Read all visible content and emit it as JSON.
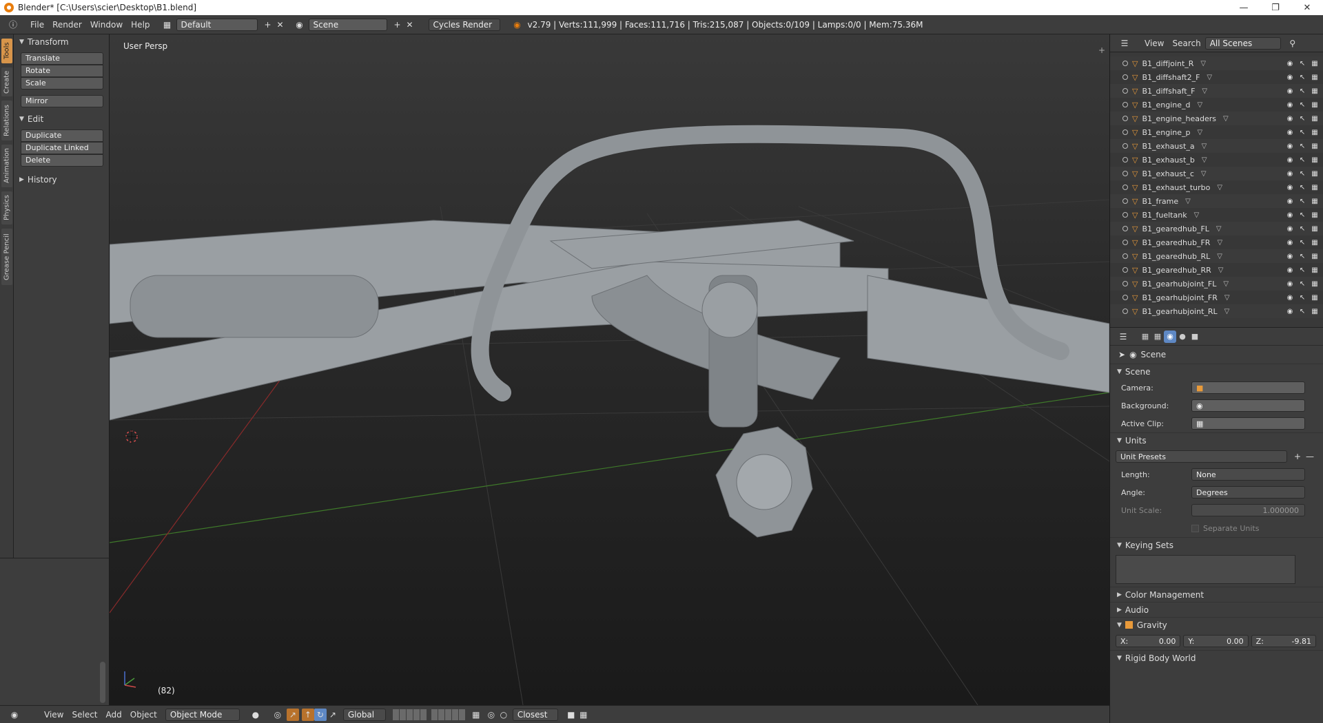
{
  "window": {
    "title": "Blender* [C:\\Users\\scier\\Desktop\\B1.blend]"
  },
  "menu": {
    "file": "File",
    "render": "Render",
    "window": "Window",
    "help": "Help"
  },
  "header": {
    "layout": "Default",
    "scene": "Scene",
    "engine": "Cycles Render",
    "stats": "v2.79 | Verts:111,999 | Faces:111,716 | Tris:215,087 | Objects:0/109 | Lamps:0/0 | Mem:75.36M"
  },
  "tabs": [
    "Tools",
    "Create",
    "Relations",
    "Animation",
    "Physics",
    "Grease Pencil"
  ],
  "toolshelf": {
    "transform": {
      "title": "Transform",
      "translate": "Translate",
      "rotate": "Rotate",
      "scale": "Scale",
      "mirror": "Mirror"
    },
    "edit": {
      "title": "Edit",
      "duplicate": "Duplicate",
      "duplicate_linked": "Duplicate Linked",
      "delete": "Delete"
    },
    "history": {
      "title": "History"
    }
  },
  "viewport": {
    "view_label": "User Persp",
    "frame": "(82)"
  },
  "bottom": {
    "view": "View",
    "select": "Select",
    "add": "Add",
    "object": "Object",
    "mode": "Object Mode",
    "orientation": "Global",
    "snap": "Closest"
  },
  "outliner": {
    "view": "View",
    "search": "Search",
    "scenes": "All Scenes",
    "items": [
      "B1_diffjoint_R",
      "B1_diffshaft2_F",
      "B1_diffshaft_F",
      "B1_engine_d",
      "B1_engine_headers",
      "B1_engine_p",
      "B1_exhaust_a",
      "B1_exhaust_b",
      "B1_exhaust_c",
      "B1_exhaust_turbo",
      "B1_frame",
      "B1_fueltank",
      "B1_gearedhub_FL",
      "B1_gearedhub_FR",
      "B1_gearedhub_RL",
      "B1_gearedhub_RR",
      "B1_gearhubjoint_FL",
      "B1_gearhubjoint_FR",
      "B1_gearhubjoint_RL"
    ]
  },
  "properties": {
    "context": "Scene",
    "scene_panel": {
      "title": "Scene",
      "camera": "Camera:",
      "background": "Background:",
      "clip": "Active Clip:"
    },
    "units": {
      "title": "Units",
      "presets": "Unit Presets",
      "length_label": "Length:",
      "length": "None",
      "angle_label": "Angle:",
      "angle": "Degrees",
      "scale_label": "Unit Scale:",
      "scale": "1.000000",
      "separate": "Separate Units"
    },
    "keying": {
      "title": "Keying Sets"
    },
    "color_mgmt": "Color Management",
    "audio": "Audio",
    "gravity": {
      "title": "Gravity",
      "x_label": "X:",
      "x": "0.00",
      "y_label": "Y:",
      "y": "0.00",
      "z_label": "Z:",
      "z": "-9.81"
    },
    "rigid": "Rigid Body World"
  }
}
